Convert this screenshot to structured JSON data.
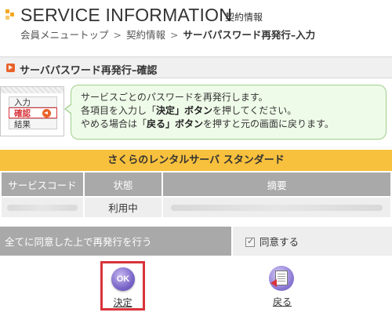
{
  "header": {
    "title": "SERVICE INFORMATION",
    "subtitle": "契約情報",
    "breadcrumb": [
      "会員メニュートップ",
      "契約情報",
      "サーバパスワード再発行–入力"
    ],
    "breadcrumb_sep": ">"
  },
  "section": {
    "title": "サーバパスワード再発行–確認"
  },
  "steps": [
    "入力",
    "確認",
    "結果"
  ],
  "info": {
    "line1": "サービスごとのパスワードを再発行します。",
    "line2_pre": "各項目を入力し「",
    "line2_bold": "決定」ボタン",
    "line2_post": "を押してください。",
    "line3_pre": "やめる場合は「",
    "line3_bold": "戻る」ボタン",
    "line3_post": "を押すと元の画面に戻ります。"
  },
  "product": {
    "name": "さくらのレンタルサーバ スタンダード"
  },
  "table": {
    "headers": [
      "サービスコード",
      "状態",
      "摘要"
    ],
    "row": {
      "status": "利用中"
    }
  },
  "agree": {
    "label": "全てに同意した上で再発行を行う",
    "checkbox_label": "同意する",
    "checked": true
  },
  "buttons": {
    "ok_icon_text": "OK",
    "ok_label": "決定",
    "back_label": "戻る"
  },
  "colors": {
    "accent_orange": "#e8622a",
    "product_bar": "#f7c03d",
    "info_bg": "#effbe9",
    "info_border": "#9fd08c",
    "highlight_red": "#d8343a",
    "table_header": "#a9a9a9"
  }
}
